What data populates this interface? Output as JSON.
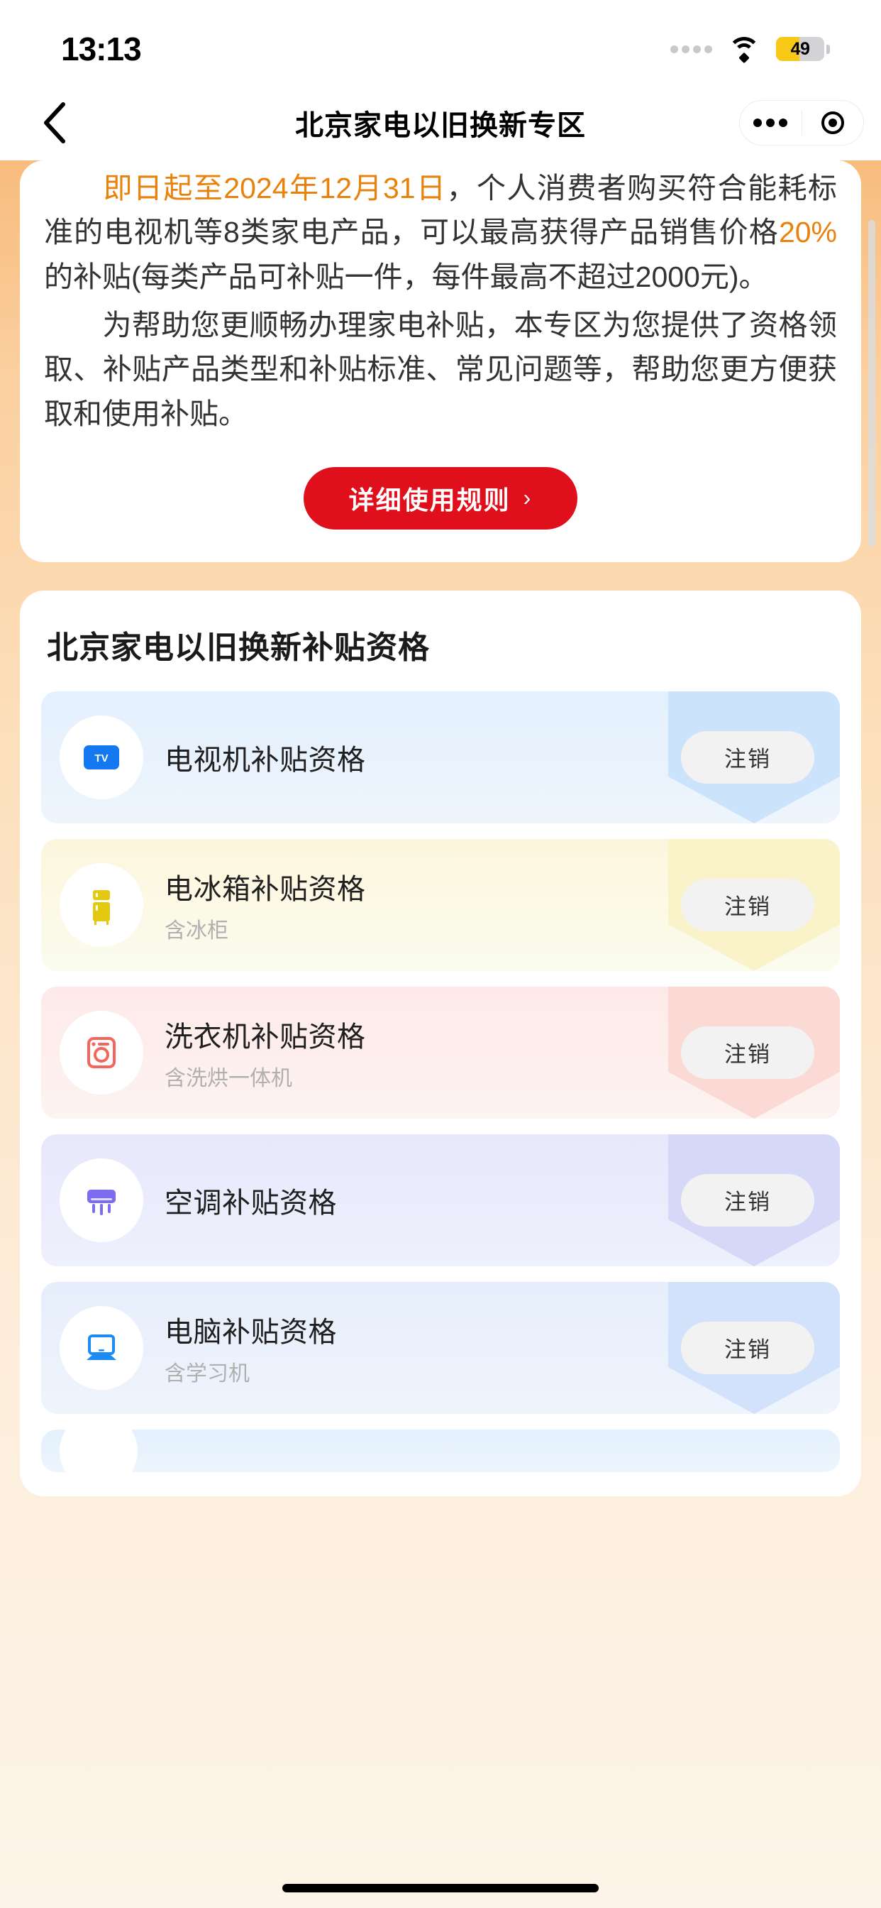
{
  "status_bar": {
    "time": "13:13",
    "battery_level": "49",
    "battery_percent": 49,
    "signal_icon": "signal-dots-icon",
    "wifi_icon": "wifi-icon",
    "battery_icon": "battery-low-power-icon",
    "battery_color": "#f7c815"
  },
  "nav": {
    "back_icon": "back-chevron-icon",
    "title": "北京家电以旧换新专区",
    "more_icon": "more-options-icon",
    "target_icon": "mini-program-close-icon"
  },
  "intro": {
    "paragraph1_highlight": "即日起至2024年12月31日",
    "paragraph1_part2": "，个人消费者购买符合能耗标准的电视机等8类家电产品，可以最高获得产品销售价格",
    "paragraph1_highlight2": "20%",
    "paragraph1_part3": "的补贴(每类产品可补贴一件，每件最高不超过2000元)。",
    "paragraph2": "为帮助您更顺畅办理家电补贴，本专区为您提供了资格领取、补贴产品类型和补贴标准、常见问题等，帮助您更方便获取和使用补贴。",
    "rule_button_label": "详细使用规则",
    "rule_button_chevron": "›",
    "highlight_color": "#e8820c",
    "button_color": "#e00f1c"
  },
  "qualification": {
    "title": "北京家电以旧换新补贴资格",
    "items": [
      {
        "name": "电视机补贴资格",
        "subtitle": "",
        "icon": "tv-icon",
        "icon_color": "#1478f0",
        "theme": "t-blue",
        "shield_color": "#cbe4fb",
        "action_label": "注销"
      },
      {
        "name": "电冰箱补贴资格",
        "subtitle": "含冰柜",
        "icon": "refrigerator-icon",
        "icon_color": "#e3c90f",
        "theme": "t-yellow",
        "shield_color": "#faf2c8",
        "action_label": "注销"
      },
      {
        "name": "洗衣机补贴资格",
        "subtitle": "含洗烘一体机",
        "icon": "washing-machine-icon",
        "icon_color": "#f4665c",
        "theme": "t-pink",
        "shield_color": "#fbd9d4",
        "action_label": "注销"
      },
      {
        "name": "空调补贴资格",
        "subtitle": "",
        "icon": "air-conditioner-icon",
        "icon_color": "#7c6cf0",
        "theme": "t-purple",
        "shield_color": "#d6d8f8",
        "action_label": "注销"
      },
      {
        "name": "电脑补贴资格",
        "subtitle": "含学习机",
        "icon": "laptop-icon",
        "icon_color": "#1c8cf5",
        "theme": "t-blue2",
        "shield_color": "#d2e2fb",
        "action_label": "注销"
      }
    ]
  }
}
